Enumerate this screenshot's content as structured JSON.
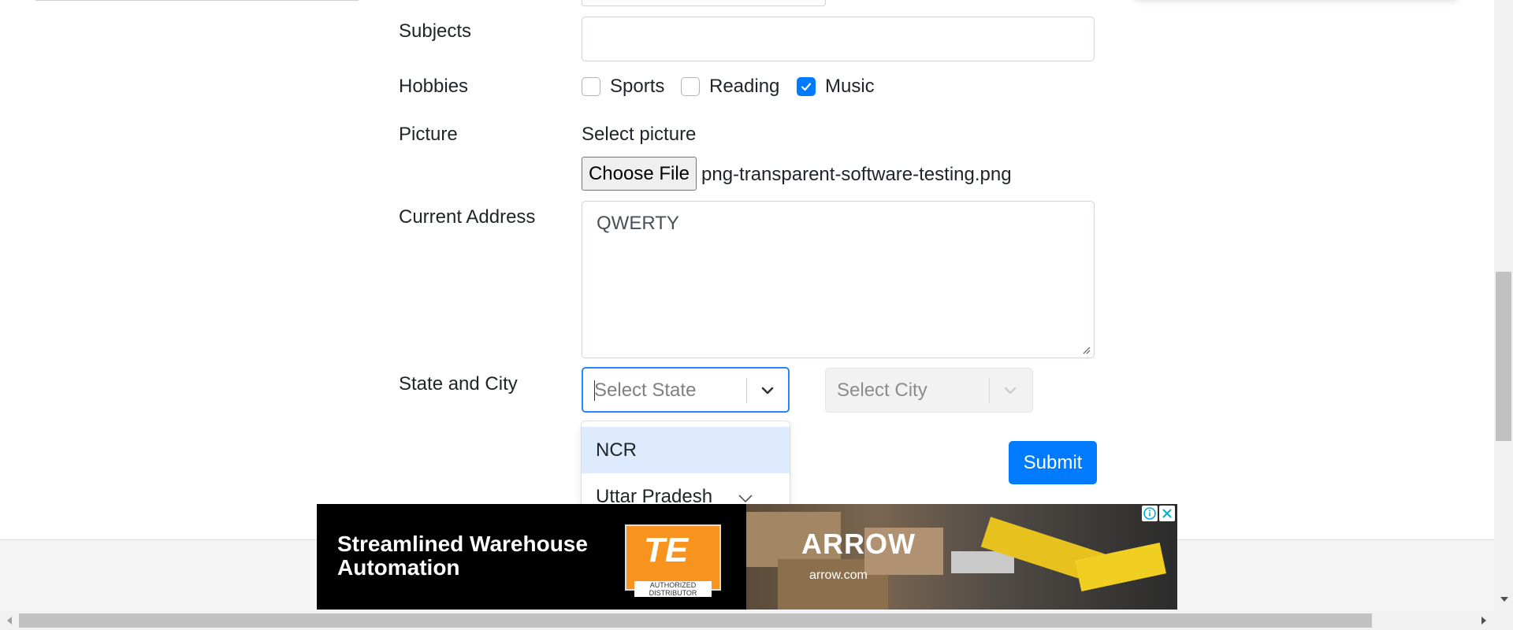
{
  "form": {
    "subjects_label": "Subjects",
    "subjects_value": "",
    "hobbies_label": "Hobbies",
    "hobbies": [
      {
        "label": "Sports",
        "checked": false
      },
      {
        "label": "Reading",
        "checked": false
      },
      {
        "label": "Music",
        "checked": true
      }
    ],
    "picture_label": "Picture",
    "select_picture_label": "Select picture",
    "choose_file_label": "Choose File",
    "file_name": "png-transparent-software-testing.png",
    "address_label": "Current Address",
    "address_value": "QWERTY",
    "state_city_label": "State and City",
    "state_placeholder": "Select State",
    "city_placeholder": "Select City",
    "state_options": [
      "NCR",
      "Uttar Pradesh"
    ],
    "submit_label": "Submit"
  },
  "ad": {
    "headline": "Streamlined Warehouse Automation",
    "te_logo_text": "TE",
    "te_subtext": "AUTHORIZED DISTRIBUTOR",
    "arrow_logo_text": "ARROW",
    "arrow_url": "arrow.com"
  },
  "colors": {
    "accent": "#007bff",
    "focus_border": "#2684ff",
    "option_highlight": "#deebff",
    "te_orange": "#f7931e"
  },
  "icons": {
    "dropdown": "chevron-down-icon",
    "checked": "checkmark-icon",
    "ad_info": "info-icon",
    "ad_close": "close-icon"
  }
}
